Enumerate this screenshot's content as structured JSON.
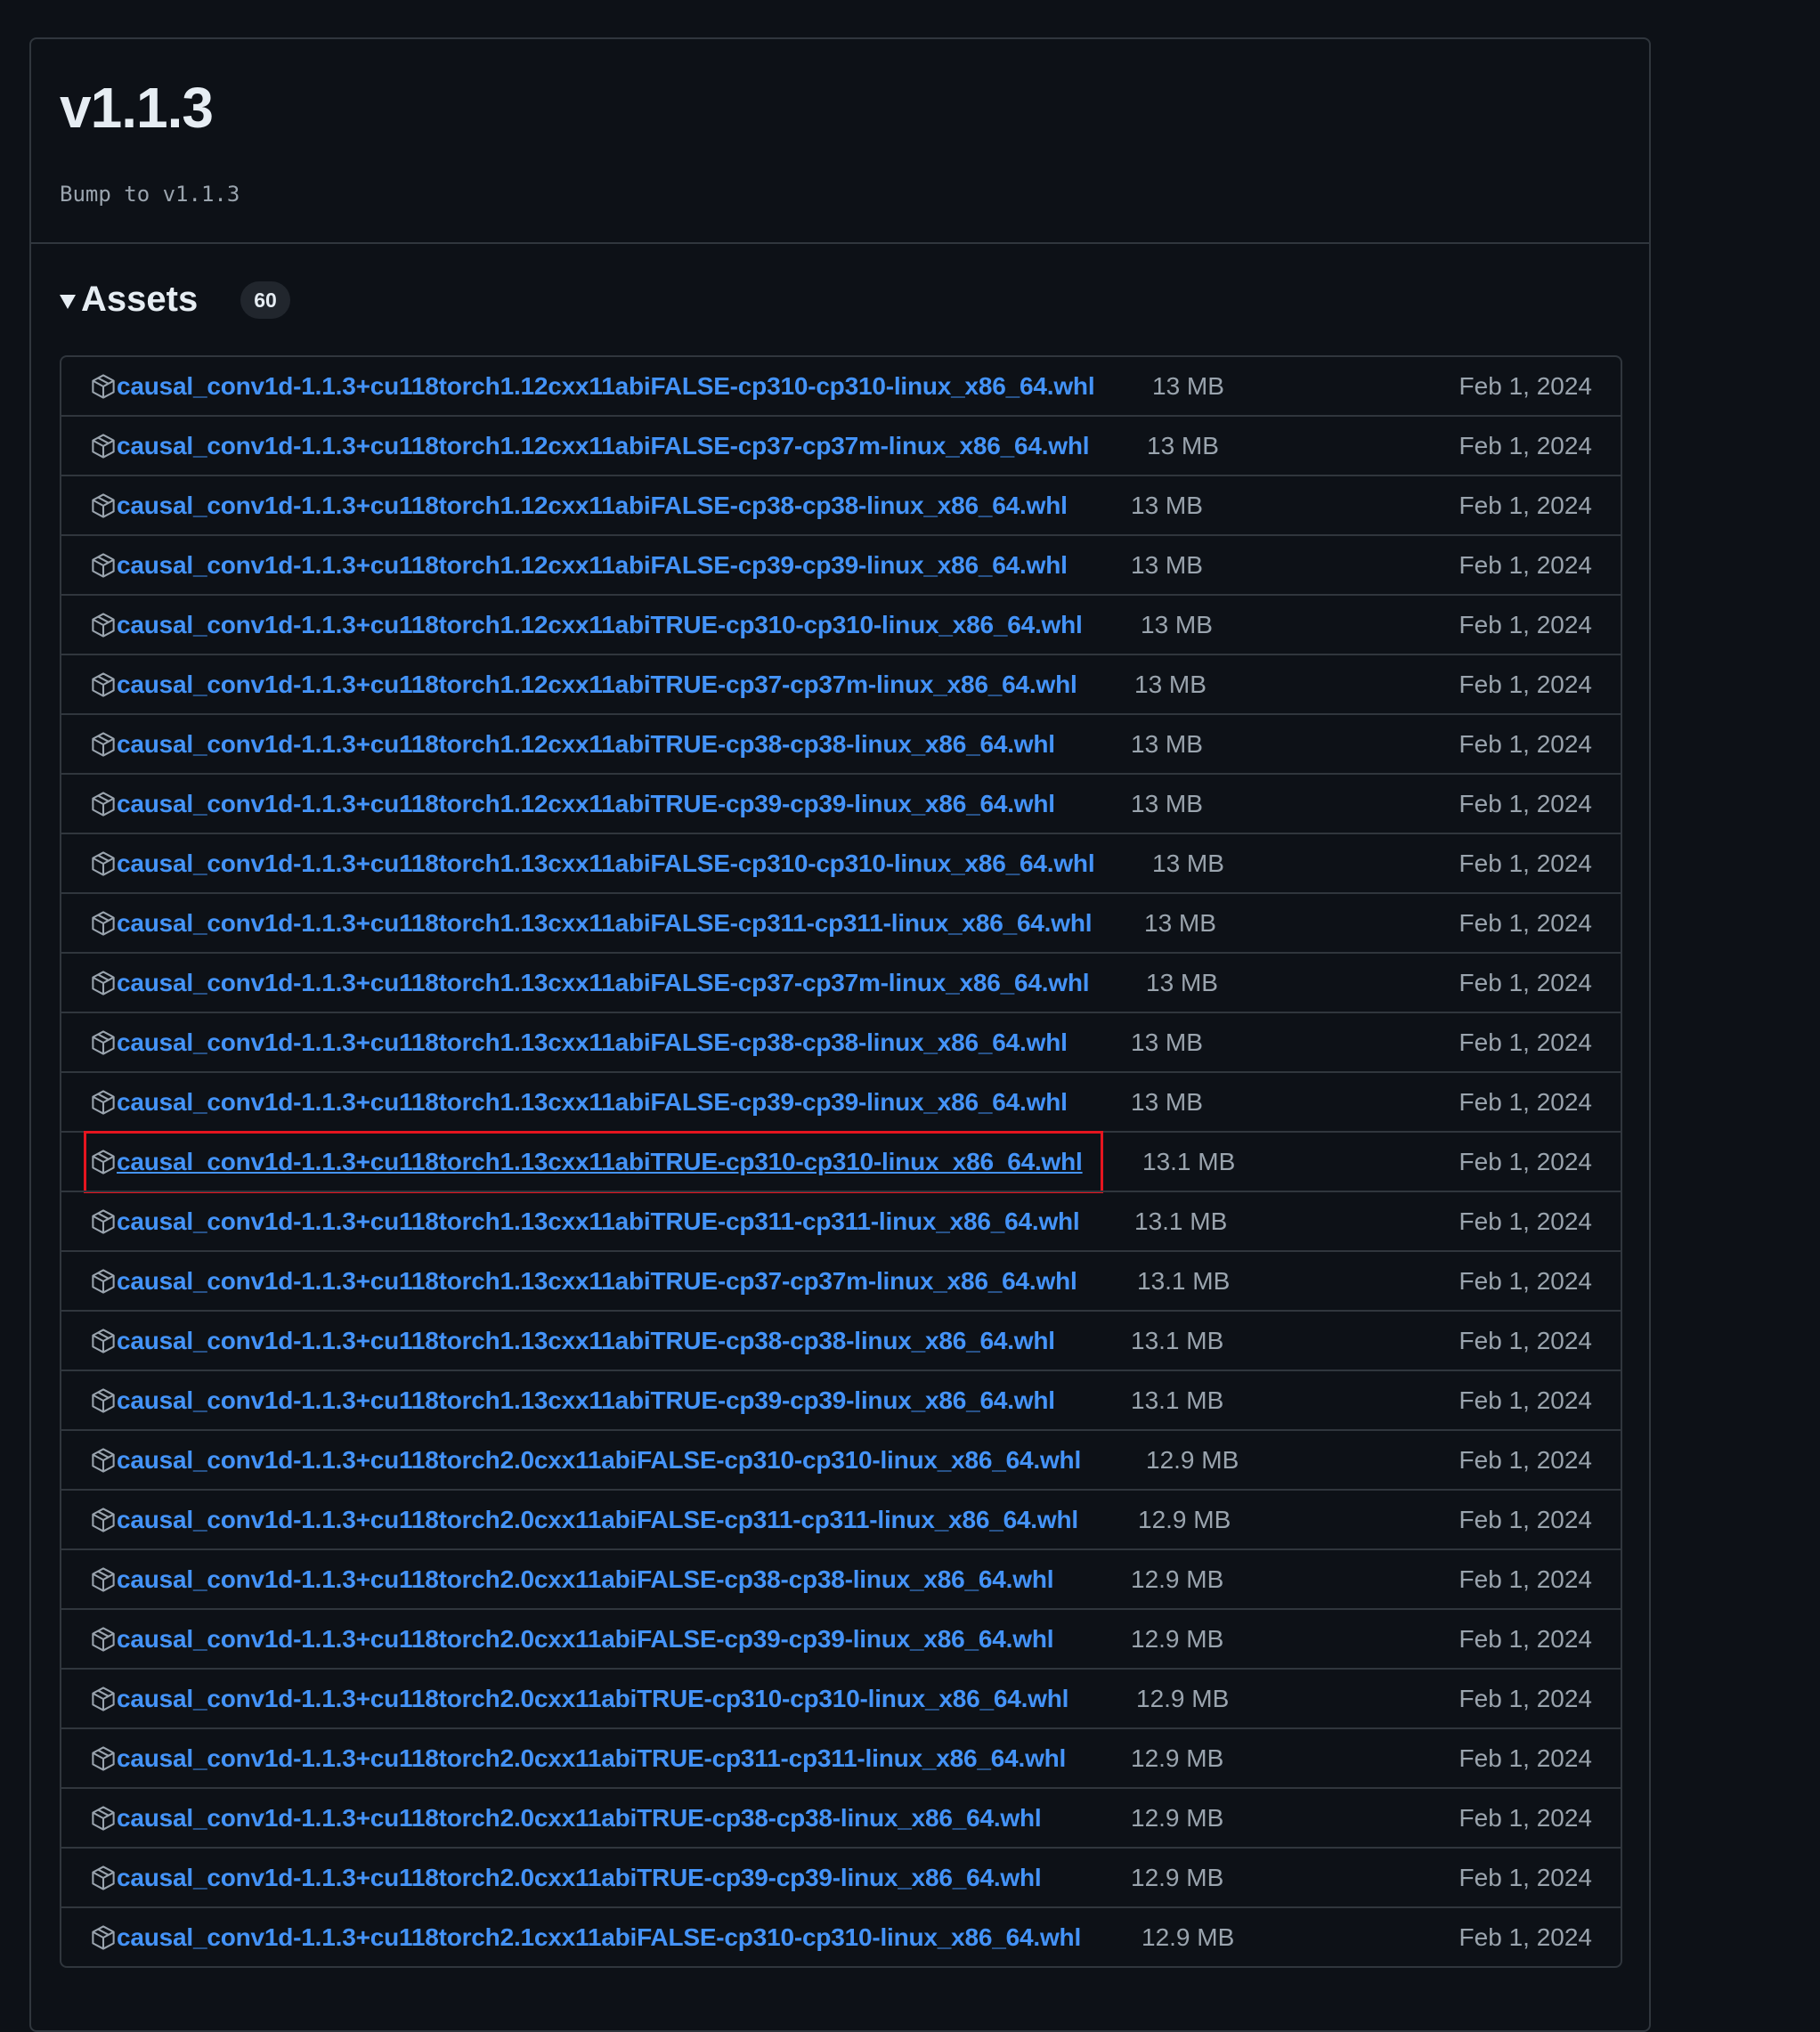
{
  "release": {
    "title": "v1.1.3",
    "body": "Bump to v1.1.3"
  },
  "assets": {
    "label": "Assets",
    "count": "60",
    "items": [
      {
        "name": "causal_conv1d-1.1.3+cu118torch1.12cxx11abiFALSE-cp310-cp310-linux_x86_64.whl",
        "size": "13 MB",
        "date": "Feb 1, 2024"
      },
      {
        "name": "causal_conv1d-1.1.3+cu118torch1.12cxx11abiFALSE-cp37-cp37m-linux_x86_64.whl",
        "size": "13 MB",
        "date": "Feb 1, 2024"
      },
      {
        "name": "causal_conv1d-1.1.3+cu118torch1.12cxx11abiFALSE-cp38-cp38-linux_x86_64.whl",
        "size": "13 MB",
        "date": "Feb 1, 2024"
      },
      {
        "name": "causal_conv1d-1.1.3+cu118torch1.12cxx11abiFALSE-cp39-cp39-linux_x86_64.whl",
        "size": "13 MB",
        "date": "Feb 1, 2024"
      },
      {
        "name": "causal_conv1d-1.1.3+cu118torch1.12cxx11abiTRUE-cp310-cp310-linux_x86_64.whl",
        "size": "13 MB",
        "date": "Feb 1, 2024"
      },
      {
        "name": "causal_conv1d-1.1.3+cu118torch1.12cxx11abiTRUE-cp37-cp37m-linux_x86_64.whl",
        "size": "13 MB",
        "date": "Feb 1, 2024"
      },
      {
        "name": "causal_conv1d-1.1.3+cu118torch1.12cxx11abiTRUE-cp38-cp38-linux_x86_64.whl",
        "size": "13 MB",
        "date": "Feb 1, 2024"
      },
      {
        "name": "causal_conv1d-1.1.3+cu118torch1.12cxx11abiTRUE-cp39-cp39-linux_x86_64.whl",
        "size": "13 MB",
        "date": "Feb 1, 2024"
      },
      {
        "name": "causal_conv1d-1.1.3+cu118torch1.13cxx11abiFALSE-cp310-cp310-linux_x86_64.whl",
        "size": "13 MB",
        "date": "Feb 1, 2024"
      },
      {
        "name": "causal_conv1d-1.1.3+cu118torch1.13cxx11abiFALSE-cp311-cp311-linux_x86_64.whl",
        "size": "13 MB",
        "date": "Feb 1, 2024"
      },
      {
        "name": "causal_conv1d-1.1.3+cu118torch1.13cxx11abiFALSE-cp37-cp37m-linux_x86_64.whl",
        "size": "13 MB",
        "date": "Feb 1, 2024"
      },
      {
        "name": "causal_conv1d-1.1.3+cu118torch1.13cxx11abiFALSE-cp38-cp38-linux_x86_64.whl",
        "size": "13 MB",
        "date": "Feb 1, 2024"
      },
      {
        "name": "causal_conv1d-1.1.3+cu118torch1.13cxx11abiFALSE-cp39-cp39-linux_x86_64.whl",
        "size": "13 MB",
        "date": "Feb 1, 2024"
      },
      {
        "name": "causal_conv1d-1.1.3+cu118torch1.13cxx11abiTRUE-cp310-cp310-linux_x86_64.whl",
        "size": "13.1 MB",
        "date": "Feb 1, 2024"
      },
      {
        "name": "causal_conv1d-1.1.3+cu118torch1.13cxx11abiTRUE-cp311-cp311-linux_x86_64.whl",
        "size": "13.1 MB",
        "date": "Feb 1, 2024"
      },
      {
        "name": "causal_conv1d-1.1.3+cu118torch1.13cxx11abiTRUE-cp37-cp37m-linux_x86_64.whl",
        "size": "13.1 MB",
        "date": "Feb 1, 2024"
      },
      {
        "name": "causal_conv1d-1.1.3+cu118torch1.13cxx11abiTRUE-cp38-cp38-linux_x86_64.whl",
        "size": "13.1 MB",
        "date": "Feb 1, 2024"
      },
      {
        "name": "causal_conv1d-1.1.3+cu118torch1.13cxx11abiTRUE-cp39-cp39-linux_x86_64.whl",
        "size": "13.1 MB",
        "date": "Feb 1, 2024"
      },
      {
        "name": "causal_conv1d-1.1.3+cu118torch2.0cxx11abiFALSE-cp310-cp310-linux_x86_64.whl",
        "size": "12.9 MB",
        "date": "Feb 1, 2024"
      },
      {
        "name": "causal_conv1d-1.1.3+cu118torch2.0cxx11abiFALSE-cp311-cp311-linux_x86_64.whl",
        "size": "12.9 MB",
        "date": "Feb 1, 2024"
      },
      {
        "name": "causal_conv1d-1.1.3+cu118torch2.0cxx11abiFALSE-cp38-cp38-linux_x86_64.whl",
        "size": "12.9 MB",
        "date": "Feb 1, 2024"
      },
      {
        "name": "causal_conv1d-1.1.3+cu118torch2.0cxx11abiFALSE-cp39-cp39-linux_x86_64.whl",
        "size": "12.9 MB",
        "date": "Feb 1, 2024"
      },
      {
        "name": "causal_conv1d-1.1.3+cu118torch2.0cxx11abiTRUE-cp310-cp310-linux_x86_64.whl",
        "size": "12.9 MB",
        "date": "Feb 1, 2024"
      },
      {
        "name": "causal_conv1d-1.1.3+cu118torch2.0cxx11abiTRUE-cp311-cp311-linux_x86_64.whl",
        "size": "12.9 MB",
        "date": "Feb 1, 2024"
      },
      {
        "name": "causal_conv1d-1.1.3+cu118torch2.0cxx11abiTRUE-cp38-cp38-linux_x86_64.whl",
        "size": "12.9 MB",
        "date": "Feb 1, 2024"
      },
      {
        "name": "causal_conv1d-1.1.3+cu118torch2.0cxx11abiTRUE-cp39-cp39-linux_x86_64.whl",
        "size": "12.9 MB",
        "date": "Feb 1, 2024"
      },
      {
        "name": "causal_conv1d-1.1.3+cu118torch2.1cxx11abiFALSE-cp310-cp310-linux_x86_64.whl",
        "size": "12.9 MB",
        "date": "Feb 1, 2024"
      }
    ]
  },
  "highlighted_index": 13,
  "colors": {
    "background": "#0d1117",
    "border": "#30363d",
    "link": "#4493f8",
    "muted": "#9aa4ae",
    "highlight": "#e5151f"
  },
  "icons": {
    "asset": "package-icon",
    "toggle": "caret-down-icon"
  }
}
